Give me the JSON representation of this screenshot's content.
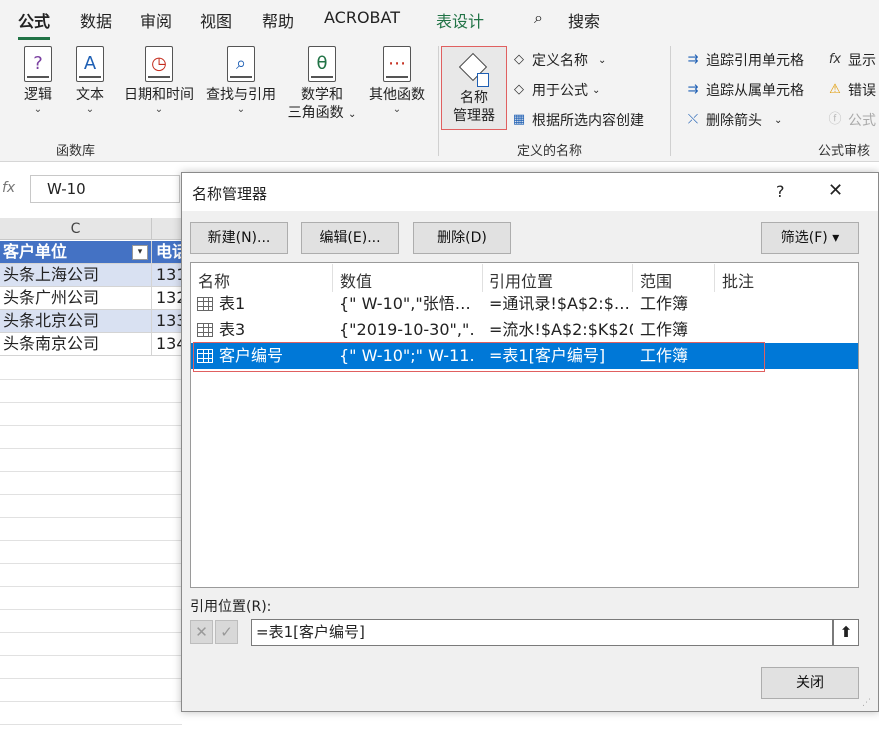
{
  "tabs": [
    "公式",
    "数据",
    "审阅",
    "视图",
    "帮助",
    "ACROBAT",
    "表设计"
  ],
  "search": {
    "label": "搜索"
  },
  "ribbon": {
    "function_library": {
      "buttons": [
        {
          "line1": "逻辑",
          "line2": ""
        },
        {
          "line1": "文本",
          "line2": ""
        },
        {
          "line1": "日期和时间",
          "line2": ""
        },
        {
          "line1": "查找与引用",
          "line2": ""
        },
        {
          "line1": "数学和",
          "line2": "三角函数"
        },
        {
          "line1": "其他函数",
          "line2": ""
        }
      ],
      "icon_glyphs": [
        "?",
        "A",
        "◷",
        "⌕",
        "θ",
        "⋯"
      ],
      "group_label": "函数库"
    },
    "defined_names": {
      "name_manager_line1": "名称",
      "name_manager_line2": "管理器",
      "define_name": "定义名称",
      "use_in_formula": "用于公式",
      "create_from_selection": "根据所选内容创建",
      "group_label": "定义的名称"
    },
    "formula_auditing": {
      "trace_precedents": "追踪引用单元格",
      "trace_dependents": "追踪从属单元格",
      "remove_arrows": "删除箭头",
      "show_formulas": "显示",
      "error_checking": "错误",
      "evaluate_formula": "公式",
      "group_label": "公式审核"
    }
  },
  "formula_bar": {
    "fx": "fx",
    "name_box": "W-10"
  },
  "sheet": {
    "column_c": "C",
    "header_c": "客户单位",
    "header_d": "电话",
    "rows": [
      {
        "c": "头条上海公司",
        "d": "131"
      },
      {
        "c": "头条广州公司",
        "d": "132"
      },
      {
        "c": "头条北京公司",
        "d": "133"
      },
      {
        "c": "头条南京公司",
        "d": "134"
      }
    ]
  },
  "dialog": {
    "title": "名称管理器",
    "help": "?",
    "close_x": "✕",
    "new_btn": "新建(N)...",
    "edit_btn": "编辑(E)...",
    "delete_btn": "删除(D)",
    "filter_btn": "筛选(F) ▾",
    "columns": [
      "名称",
      "数值",
      "引用位置",
      "范围",
      "批注"
    ],
    "rows": [
      {
        "name": "表1",
        "value": "{\" W-10\",\"张悟…",
        "ref": "=通讯录!$A$2:$…",
        "scope": "工作簿",
        "comment": ""
      },
      {
        "name": "表3",
        "value": "{\"2019-10-30\",\"…",
        "ref": "=流水!$A$2:$K$20",
        "scope": "工作簿",
        "comment": ""
      },
      {
        "name": "客户编号",
        "value": "{\" W-10\";\" W-11…",
        "ref": "=表1[客户编号]",
        "scope": "工作簿",
        "comment": ""
      }
    ],
    "ref_label": "引用位置(R):",
    "ref_value": "=表1[客户编号]",
    "close_btn": "关闭"
  },
  "colors": {
    "accent": "#217346",
    "selection": "#0078d7",
    "highlight_border": "#e06060",
    "table_header": "#4472c4"
  }
}
